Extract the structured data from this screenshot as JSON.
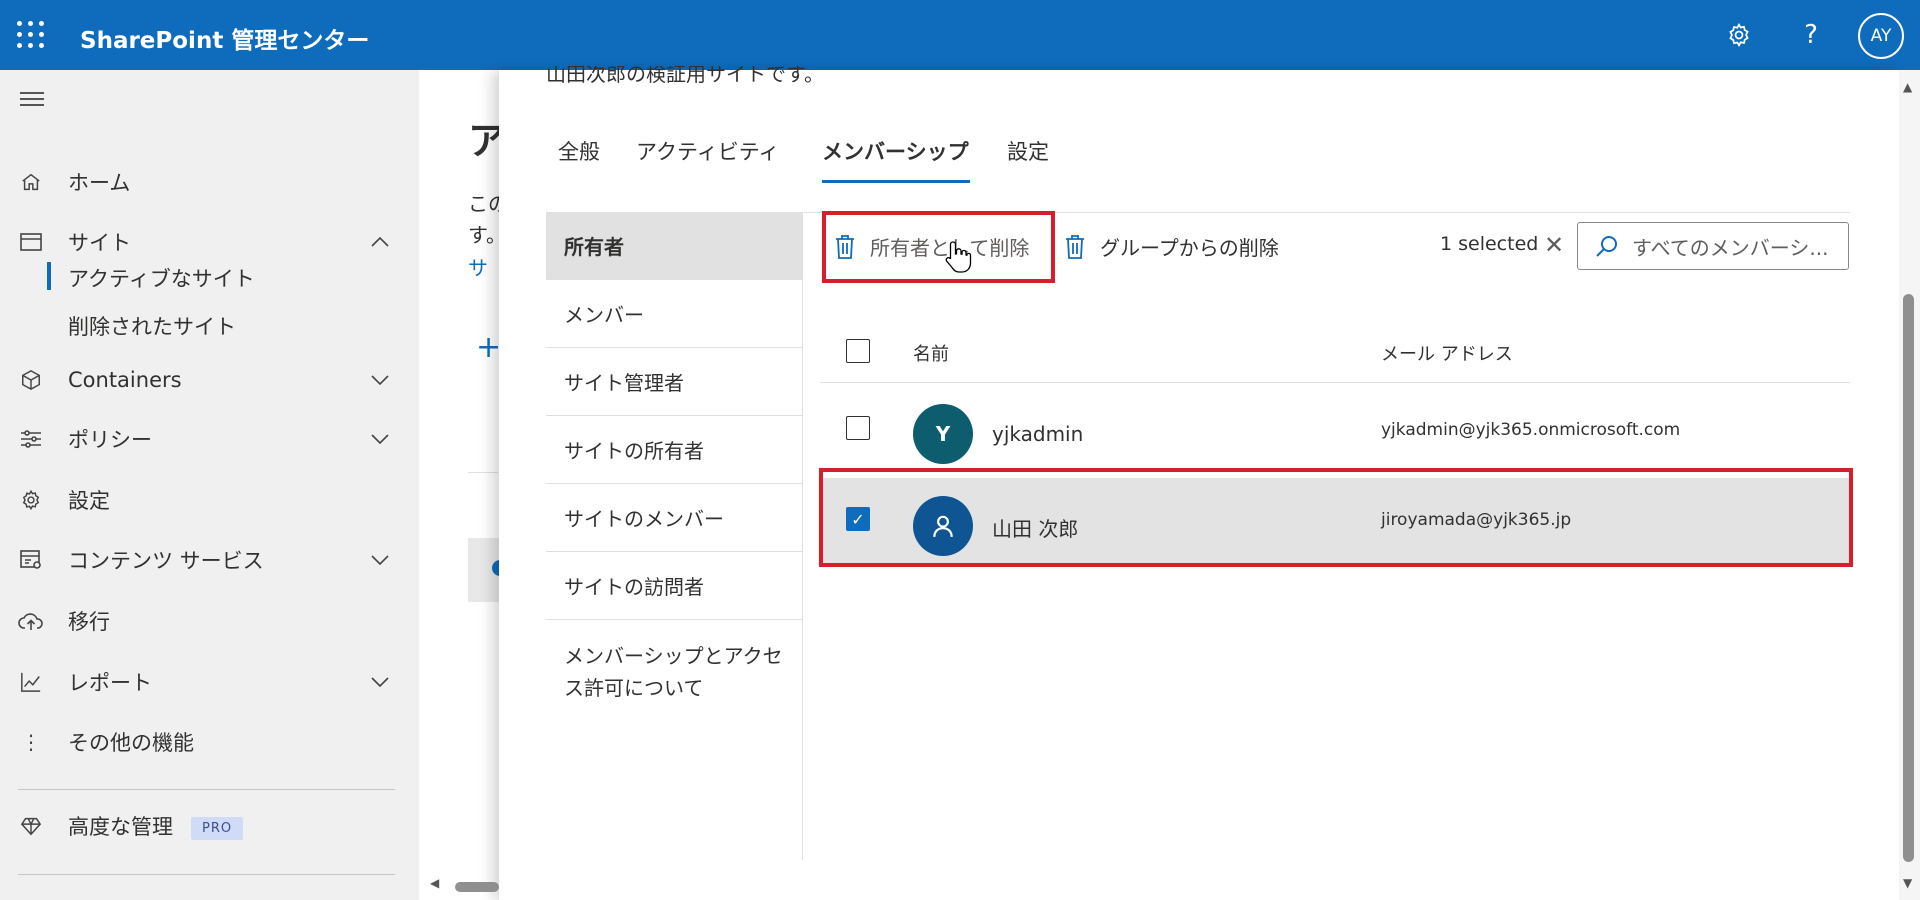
{
  "topbar": {
    "app_title": "SharePoint 管理センター",
    "avatar_initials": "AY",
    "icons": [
      "waffle-icon",
      "settings-gear-icon",
      "help-icon"
    ],
    "color": "#0f6cbd"
  },
  "leftnav": {
    "items": [
      {
        "label": "ホーム",
        "icon": "home-icon"
      },
      {
        "label": "サイト",
        "icon": "window-icon",
        "expanded": true
      },
      {
        "label": "Containers",
        "icon": "cube-icon"
      },
      {
        "label": "ポリシー",
        "icon": "sliders-icon"
      },
      {
        "label": "設定",
        "icon": "gear-icon"
      },
      {
        "label": "コンテンツ サービス",
        "icon": "content-services-icon"
      },
      {
        "label": "移行",
        "icon": "cloud-upload-icon"
      },
      {
        "label": "レポート",
        "icon": "chart-icon"
      },
      {
        "label": "その他の機能",
        "icon": "more-icon"
      }
    ],
    "sub_items": [
      "アクティブなサイト",
      "削除されたサイト"
    ],
    "advanced": {
      "label": "高度な管理",
      "badge": "PRO",
      "icon": "diamond-icon"
    }
  },
  "background": {
    "title_fragment": "ア",
    "text_line1": "この",
    "text_line2": "す。",
    "link_fragment": "サ",
    "plus": "+"
  },
  "panel": {
    "description_cut": "山田次郎の検証用サイトです。",
    "tabs": [
      "全般",
      "アクティビティ",
      "メンバーシップ",
      "設定"
    ],
    "active_tab": "メンバーシップ",
    "subnav": [
      "所有者",
      "メンバー",
      "サイト管理者",
      "サイトの所有者",
      "サイトのメンバー",
      "サイトの訪問者",
      "メンバーシップとアクセス許可について"
    ],
    "subnav_selected": "所有者",
    "commands": {
      "remove_as_owner": "所有者として削除",
      "remove_from_group": "グループからの削除"
    },
    "selected_count": "1 selected",
    "search_placeholder": "すべてのメンバーシ...",
    "table": {
      "columns": [
        "名前",
        "メール アドレス"
      ],
      "rows": [
        {
          "initial": "Y",
          "name": "yjkadmin",
          "email": "yjkadmin@yjk365.onmicrosoft.com",
          "checked": false,
          "avatar_color": "#0e5d6e"
        },
        {
          "initial": "",
          "name": "山田 次郎",
          "email": "jiroyamada@yjk365.jp",
          "checked": true,
          "avatar_color": "#0f5593"
        }
      ]
    },
    "highlight_color": "#d71f2c"
  }
}
